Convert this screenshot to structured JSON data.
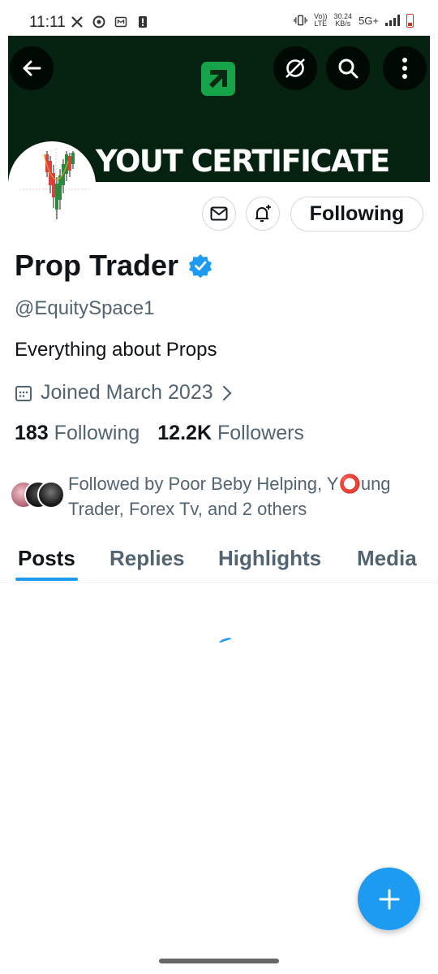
{
  "status_bar": {
    "time": "11:11",
    "volte_top": "Vo))",
    "volte_bottom": "LTE",
    "speed_value": "30.24",
    "speed_unit": "KB/s",
    "network": "5G+"
  },
  "banner": {
    "text": "YOUT CERTIFICATE",
    "background_color": "#05210f",
    "logo_color": "#16a34a"
  },
  "toolbar": {
    "back_icon": "arrow-left-icon",
    "grok_icon": "grok-icon",
    "search_icon": "search-icon",
    "more_icon": "more-vertical-icon"
  },
  "profile": {
    "display_name": "Prop Trader",
    "verified": true,
    "handle": "@EquitySpace1",
    "bio": "Everything about Props",
    "joined": "Joined March 2023",
    "following_count": "183",
    "following_label": "Following",
    "followers_count": "12.2K",
    "followers_label": "Followers",
    "followed_by": "Followed by Poor Beby Helping, Y⭕ung Trader, Forex Tv, and 2 others"
  },
  "actions": {
    "follow_state": "Following",
    "message_icon": "envelope-icon",
    "notify_icon": "bell-plus-icon"
  },
  "tabs": [
    {
      "label": "Posts",
      "active": true
    },
    {
      "label": "Replies",
      "active": false
    },
    {
      "label": "Highlights",
      "active": false
    },
    {
      "label": "Media",
      "active": false
    }
  ],
  "colors": {
    "accent": "#1d9bf0",
    "text_primary": "#0f1419",
    "text_secondary": "#536471"
  },
  "fab": {
    "icon": "plus-icon"
  }
}
